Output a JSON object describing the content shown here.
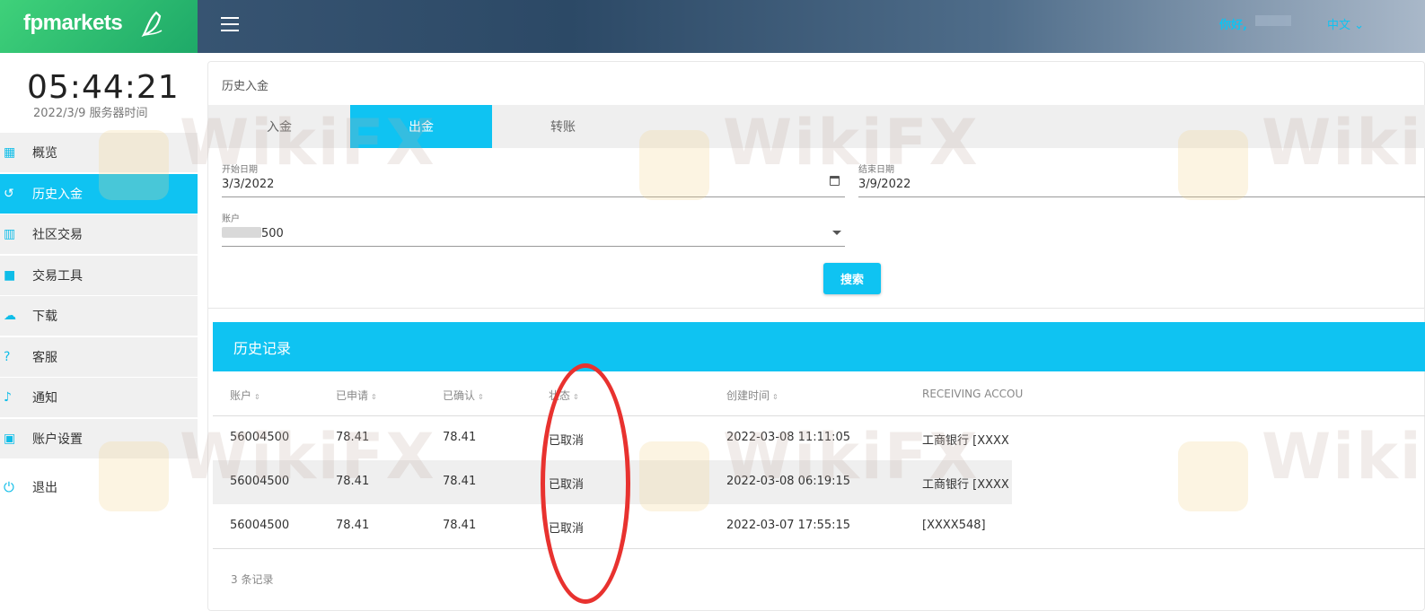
{
  "brand": {
    "name": "fpmarkets"
  },
  "header": {
    "greeting": "你好,",
    "language": "中文"
  },
  "clock": {
    "time": "05:44:21",
    "date": "2022/3/9 服务器时间"
  },
  "sidebar": {
    "items": [
      {
        "label": "概览",
        "icon": "dashboard-icon",
        "active": false
      },
      {
        "label": "历史入金",
        "icon": "history-icon",
        "active": true
      },
      {
        "label": "社区交易",
        "icon": "chart-icon",
        "active": false
      },
      {
        "label": "交易工具",
        "icon": "briefcase-icon",
        "active": false
      },
      {
        "label": "下载",
        "icon": "cloud-download-icon",
        "active": false
      },
      {
        "label": "客服",
        "icon": "help-icon",
        "active": false
      },
      {
        "label": "通知",
        "icon": "bell-icon",
        "active": false
      },
      {
        "label": "账户设置",
        "icon": "account-icon",
        "active": false
      }
    ],
    "logout": "退出"
  },
  "page": {
    "title": "历史入金",
    "tabs": [
      {
        "label": "入金",
        "active": false
      },
      {
        "label": "出金",
        "active": true
      },
      {
        "label": "转账",
        "active": false
      }
    ]
  },
  "filters": {
    "start_date_label": "开始日期",
    "start_date": "3/3/2022",
    "end_date_label": "结束日期",
    "end_date": "3/9/2022",
    "account_label": "账户",
    "account_value": "500",
    "search_label": "搜索"
  },
  "records": {
    "title": "历史记录",
    "columns": [
      "账户",
      "已申请",
      "已确认",
      "状态",
      "创建时间",
      "RECEIVING ACCOU"
    ],
    "rows": [
      [
        "56004500",
        "78.41",
        "78.41",
        "已取消",
        "2022-03-08 11:11:05",
        "工商银行 [XXXX"
      ],
      [
        "56004500",
        "78.41",
        "78.41",
        "已取消",
        "2022-03-08 06:19:15",
        "工商银行 [XXXX"
      ],
      [
        "56004500",
        "78.41",
        "78.41",
        "已取消",
        "2022-03-07 17:55:15",
        "[XXXX548]"
      ]
    ],
    "count_text": "3 条记录"
  },
  "watermark": "WikiFX",
  "colors": {
    "accent": "#0fc3f2",
    "brand_green": "#2bc070",
    "annotation_red": "#e8322f"
  }
}
